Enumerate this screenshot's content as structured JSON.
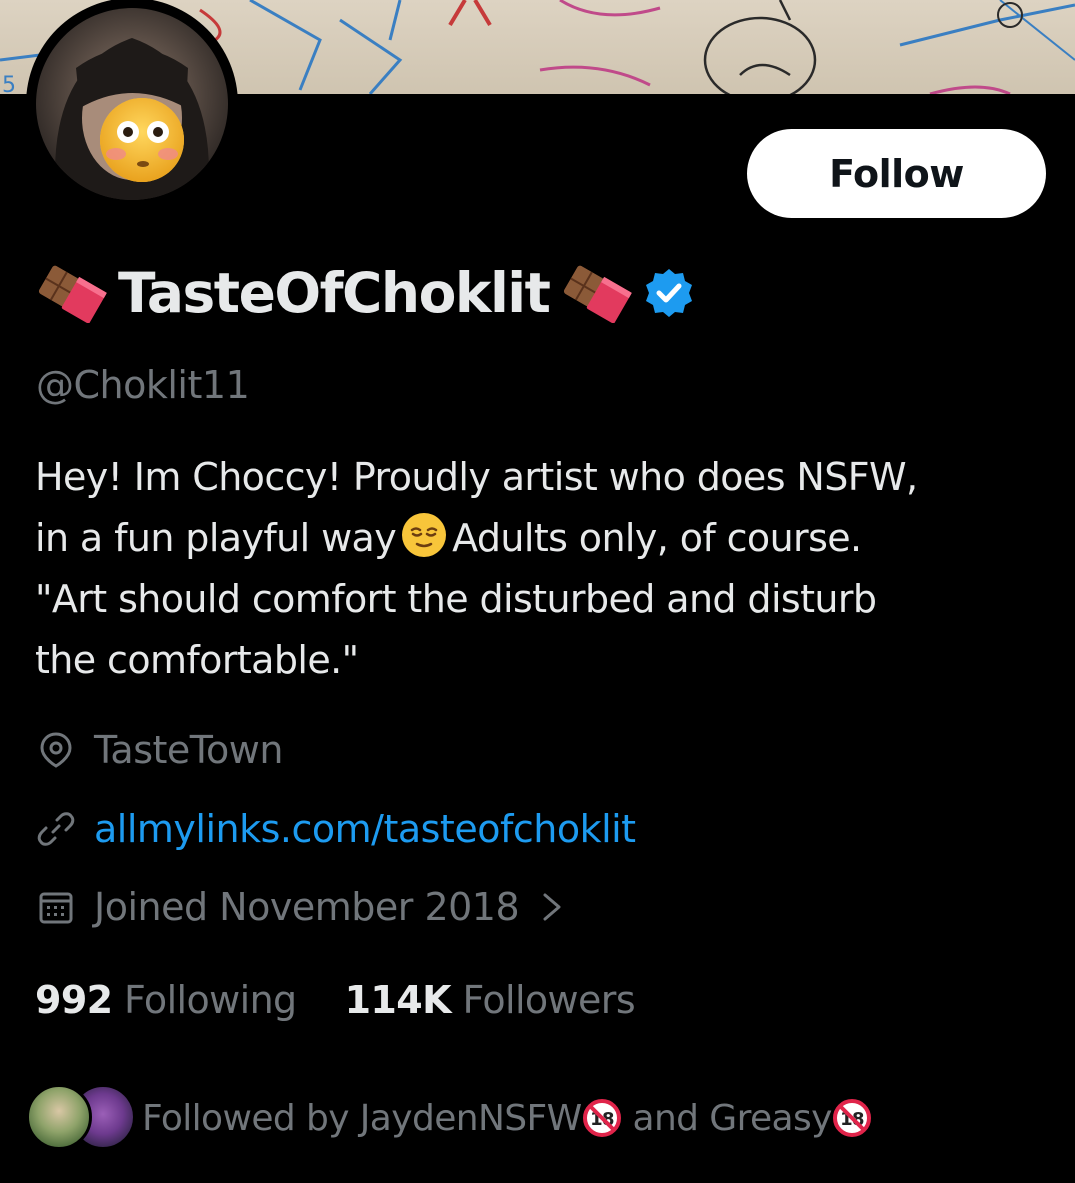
{
  "profile": {
    "display_name": "TasteOfChoklit",
    "handle": "@Choklit11",
    "verified_icon": "verified-badge-icon",
    "follow_label": "Follow",
    "bio": {
      "line1": "Hey! Im Choccy!  Proudly artist who does NSFW,",
      "line2a": "in a fun playful way",
      "line2b": "Adults only, of course.",
      "line3": "\"Art should comfort the disturbed and disturb",
      "line4": "the comfortable.\""
    },
    "location": "TasteTown",
    "website": "allmylinks.com/tasteofchoklit",
    "joined": "Joined November 2018",
    "stats": {
      "following_count": "992",
      "following_label": "Following",
      "followers_count": "114K",
      "followers_label": "Followers"
    },
    "followed_by": {
      "prefix": "Followed by",
      "user1": "JaydenNSFW",
      "joiner": "and",
      "user2": "Greasy"
    }
  },
  "colors": {
    "background": "#000000",
    "primary_text": "#e7e9ea",
    "secondary_text": "#71767b",
    "link": "#1d9bf0",
    "verified": "#1d9bf0",
    "follow_button_bg": "#ffffff"
  }
}
